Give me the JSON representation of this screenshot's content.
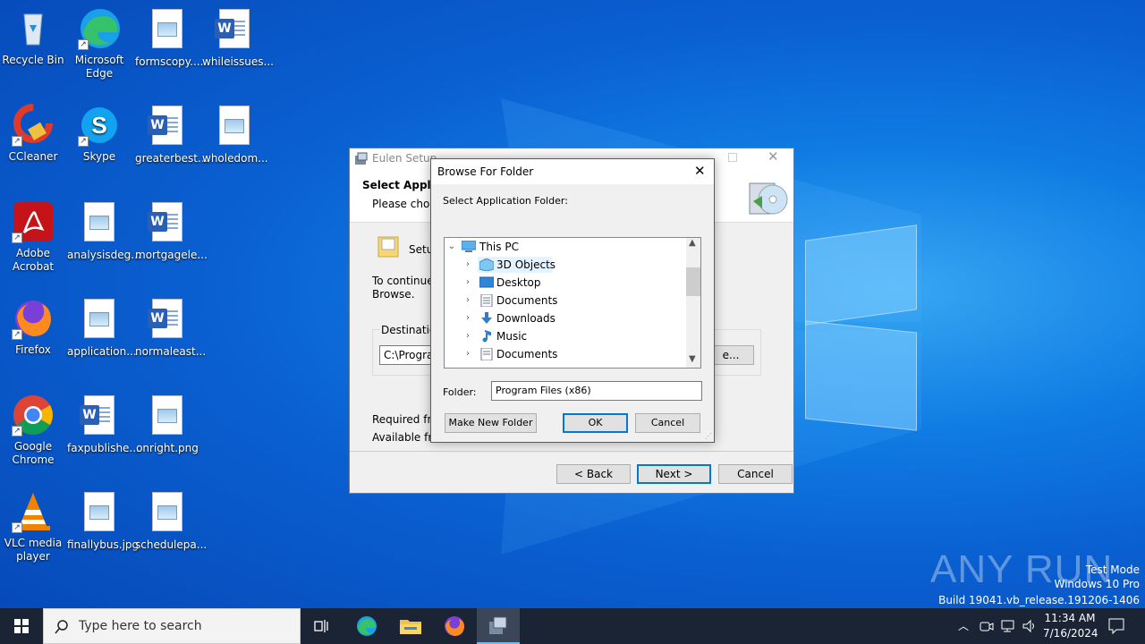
{
  "desktop": {
    "icons": [
      {
        "label": "Recycle Bin"
      },
      {
        "label": "Microsoft Edge"
      },
      {
        "label": "formscopy...."
      },
      {
        "label": "whileissues..."
      },
      {
        "label": "CCleaner"
      },
      {
        "label": "Skype"
      },
      {
        "label": "greaterbest..."
      },
      {
        "label": "wholedom..."
      },
      {
        "label": "Adobe Acrobat"
      },
      {
        "label": "analysisdeg..."
      },
      {
        "label": "mortgagele..."
      },
      {
        "label": "Firefox"
      },
      {
        "label": "application..."
      },
      {
        "label": "normaleast..."
      },
      {
        "label": "Google Chrome"
      },
      {
        "label": "faxpublishe..."
      },
      {
        "label": "onright.png"
      },
      {
        "label": "VLC media player"
      },
      {
        "label": "finallybus.jpg"
      },
      {
        "label": "schedulepa..."
      }
    ]
  },
  "setup": {
    "title": "Eulen Setup",
    "heading": "Select Applic",
    "subheading": "Please choos",
    "setup_label": "Setup",
    "continue_text_1": "To continue,",
    "continue_text_2": "Browse.",
    "destination_label": "Destination",
    "path_value": "C:\\Progra",
    "browse_label": "e...",
    "required_label": "Required fre",
    "available_label": "Available fre",
    "back_label": "< Back",
    "next_label": "Next >",
    "cancel_label": "Cancel"
  },
  "browse": {
    "title": "Browse For Folder",
    "prompt": "Select Application Folder:",
    "tree": [
      {
        "label": "This PC",
        "icon": "this-pc-icon"
      },
      {
        "label": "3D Objects",
        "icon": "3d-objects-icon"
      },
      {
        "label": "Desktop",
        "icon": "desktop-folder-icon"
      },
      {
        "label": "Documents",
        "icon": "documents-icon"
      },
      {
        "label": "Downloads",
        "icon": "downloads-icon"
      },
      {
        "label": "Music",
        "icon": "music-icon"
      },
      {
        "label": "Documents",
        "icon": "documents-icon"
      }
    ],
    "folder_label": "Folder:",
    "folder_value": "Program Files (x86)",
    "new_folder_label": "Make New Folder",
    "ok_label": "OK",
    "cancel_label": "Cancel"
  },
  "taskbar": {
    "search_placeholder": "Type here to search",
    "time": "11:34 AM",
    "date": "7/16/2024"
  },
  "watermark": {
    "line1": "Test Mode",
    "line2": "Windows 10 Pro",
    "line3": "Build 19041.vb_release.191206-1406",
    "logo_text": "ANY RUN"
  }
}
